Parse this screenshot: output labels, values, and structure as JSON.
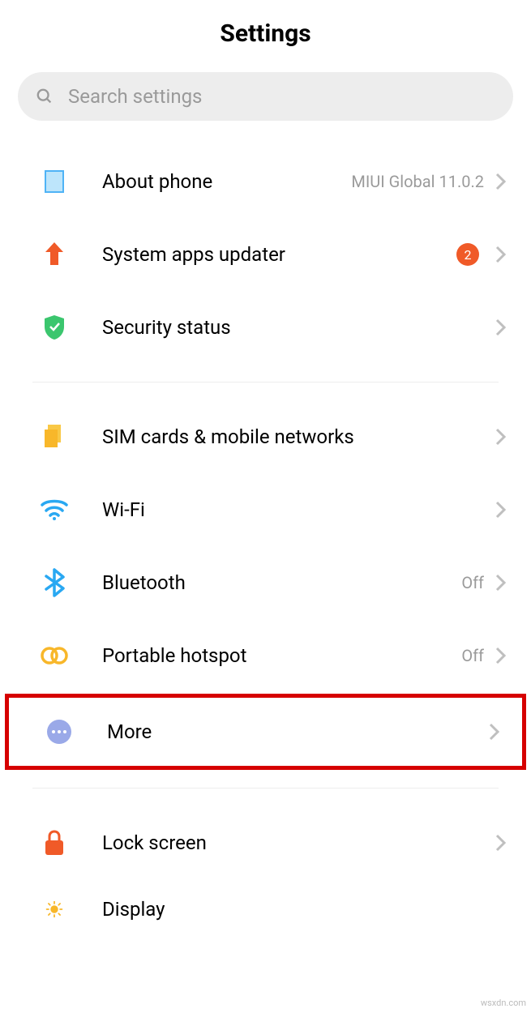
{
  "header": {
    "title": "Settings"
  },
  "search": {
    "placeholder": "Search settings"
  },
  "groups": [
    {
      "items": [
        {
          "icon": "phone-icon",
          "label": "About phone",
          "value": "MIUI Global 11.0.2",
          "badge": null
        },
        {
          "icon": "uploader-icon",
          "label": "System apps updater",
          "value": null,
          "badge": "2"
        },
        {
          "icon": "shield-icon",
          "label": "Security status",
          "value": null,
          "badge": null
        }
      ]
    },
    {
      "items": [
        {
          "icon": "sim-icon",
          "label": "SIM cards & mobile networks",
          "value": null,
          "badge": null
        },
        {
          "icon": "wifi-icon",
          "label": "Wi-Fi",
          "value": null,
          "badge": null
        },
        {
          "icon": "bluetooth-icon",
          "label": "Bluetooth",
          "value": "Off",
          "badge": null
        },
        {
          "icon": "hotspot-icon",
          "label": "Portable hotspot",
          "value": "Off",
          "badge": null
        },
        {
          "icon": "more-icon",
          "label": "More",
          "value": null,
          "badge": null,
          "highlighted": true
        }
      ]
    },
    {
      "items": [
        {
          "icon": "lock-icon",
          "label": "Lock screen",
          "value": null,
          "badge": null
        }
      ],
      "partial": {
        "icon": "display-icon",
        "label": "Display"
      }
    }
  ],
  "watermark": "wsxdn.com"
}
